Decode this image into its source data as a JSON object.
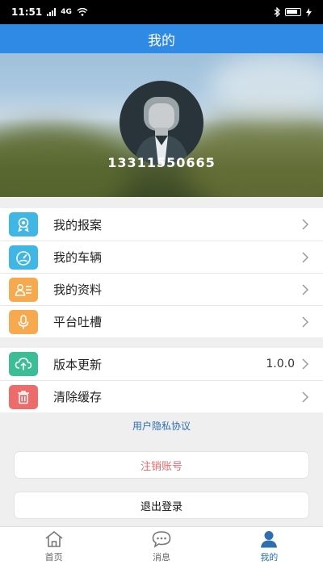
{
  "status_bar": {
    "time": "11:51",
    "network": "4G",
    "battery": ""
  },
  "header": {
    "title": "我的"
  },
  "profile": {
    "phone": "13311550665"
  },
  "menu_group1": [
    {
      "label": "我的报案",
      "icon": "badge-icon",
      "color": "#3fb6e3"
    },
    {
      "label": "我的车辆",
      "icon": "speedometer-icon",
      "color": "#3fb6e3"
    },
    {
      "label": "我的资料",
      "icon": "profile-card-icon",
      "color": "#f6a94e"
    },
    {
      "label": "平台吐槽",
      "icon": "microphone-icon",
      "color": "#f6a94e"
    }
  ],
  "menu_group2": [
    {
      "label": "版本更新",
      "value": "1.0.0",
      "icon": "cloud-upload-icon",
      "color": "#3dbd95"
    },
    {
      "label": "清除缓存",
      "icon": "trash-icon",
      "color": "#ee6b6b"
    }
  ],
  "privacy_link": "用户隐私协议",
  "buttons": {
    "cancel_account": "注销账号",
    "logout": "退出登录"
  },
  "tabs": [
    {
      "label": "首页",
      "icon": "home-icon",
      "active": false
    },
    {
      "label": "消息",
      "icon": "chat-icon",
      "active": false
    },
    {
      "label": "我的",
      "icon": "user-icon",
      "active": true
    }
  ],
  "colors": {
    "primary": "#2f8ae6",
    "link": "#2f6fb0",
    "danger": "#e26a6a"
  }
}
